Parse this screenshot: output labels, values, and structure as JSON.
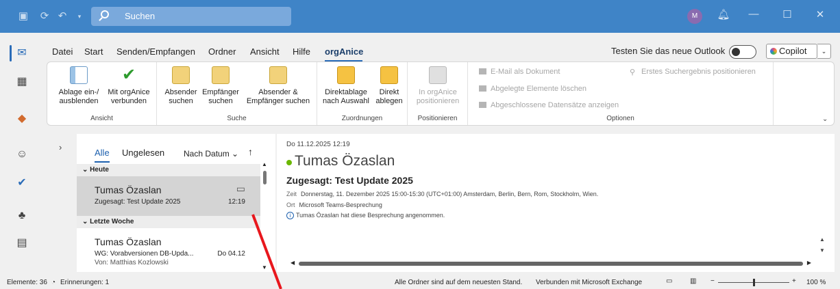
{
  "titlebar": {
    "search_placeholder": "Suchen",
    "avatar_initial": "M"
  },
  "menu": {
    "items": [
      "Datei",
      "Start",
      "Senden/Empfangen",
      "Ordner",
      "Ansicht",
      "Hilfe",
      "orgAnice"
    ],
    "try_new": "Testen Sie das neue Outlook",
    "copilot": "Copilot"
  },
  "ribbon": {
    "groups": {
      "ansicht": {
        "label": "Ansicht",
        "btn1": [
          "Ablage ein-/",
          "ausblenden"
        ],
        "btn2": [
          "Mit orgAnice",
          "verbunden"
        ]
      },
      "suche": {
        "label": "Suche",
        "btn1": [
          "Absender",
          "suchen"
        ],
        "btn2": [
          "Empfänger",
          "suchen"
        ],
        "btn3": [
          "Absender &",
          "Empfänger suchen"
        ]
      },
      "zuordnungen": {
        "label": "Zuordnungen",
        "btn1": [
          "Direktablage",
          "nach Auswahl"
        ],
        "btn2": [
          "Direkt",
          "ablegen"
        ]
      },
      "positionieren": {
        "label": "Positionieren",
        "btn1": [
          "In orgAnice",
          "positionieren"
        ]
      },
      "optionen": {
        "label": "Optionen",
        "items": [
          "E-Mail als Dokument",
          "Abgelegte Elemente löschen",
          "Abgeschlossene Datensätze anzeigen"
        ],
        "first_result": "Erstes Suchergebnis positionieren"
      }
    }
  },
  "list": {
    "filters": [
      "Alle",
      "Ungelesen"
    ],
    "sort": "Nach Datum",
    "groups": [
      {
        "label": "Heute",
        "items": [
          {
            "sender": "Tumas Özaslan",
            "subject": "Zugesagt: Test Update 2025",
            "time": "12:19"
          }
        ]
      },
      {
        "label": "Letzte Woche",
        "items": [
          {
            "sender": "Tumas Özaslan",
            "subject": "WG: Vorabversionen DB-Upda...",
            "time": "Do 04.12",
            "from": "Von: Matthias Kozlowski"
          }
        ]
      }
    ]
  },
  "reading": {
    "date": "Do 11.12.2025 12:19",
    "sender": "Tumas Özaslan",
    "subject": "Zugesagt: Test Update 2025",
    "zeit_label": "Zeit",
    "zeit": "Donnerstag, 11. Dezember 2025 15:00-15:30 (UTC+01:00) Amsterdam, Berlin, Bern, Rom, Stockholm, Wien.",
    "ort_label": "Ort",
    "ort": "Microsoft Teams-Besprechung",
    "info": "Tumas Özaslan hat diese Besprechung angenommen."
  },
  "status": {
    "elements": "Elemente: 36",
    "reminders": "Erinnerungen: 1",
    "folders": "Alle Ordner sind auf dem neuesten Stand.",
    "connection": "Verbunden mit Microsoft Exchange",
    "zoom": "100 %"
  },
  "colors": {
    "titlebar": "#3f84c7",
    "accent": "#1b5fae",
    "presence": "#6bb700",
    "annotation": "#e8171d"
  }
}
